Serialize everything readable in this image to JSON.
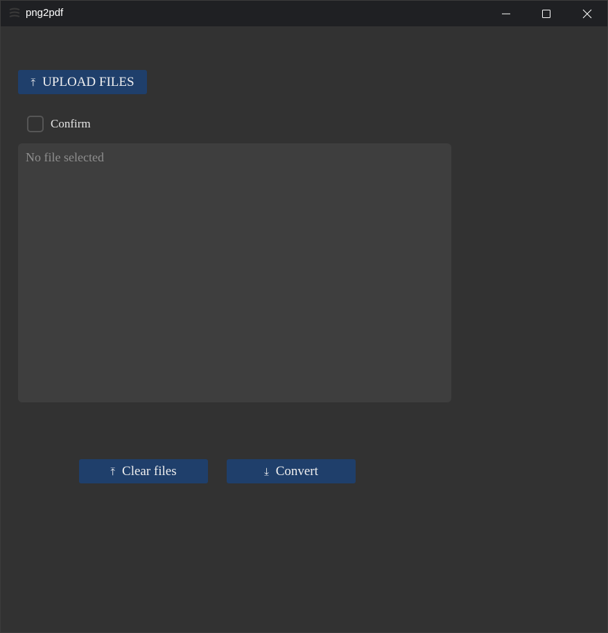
{
  "window": {
    "title": "png2pdf",
    "controls": {
      "minimize": "minimize-icon",
      "maximize": "maximize-icon",
      "close": "close-icon"
    }
  },
  "main": {
    "upload_button": {
      "label": "UPLOAD FILES",
      "icon": "upload-icon"
    },
    "confirm": {
      "label": "Confirm",
      "checked": false
    },
    "file_list": {
      "placeholder": "No file selected"
    },
    "clear_button": {
      "label": "Clear files",
      "icon": "upload-icon"
    },
    "convert_button": {
      "label": "Convert",
      "icon": "download-icon"
    }
  },
  "colors": {
    "background": "#323232",
    "titlebar": "#1f2023",
    "button": "#1f3f6b",
    "file_area": "#3e3e3e"
  }
}
